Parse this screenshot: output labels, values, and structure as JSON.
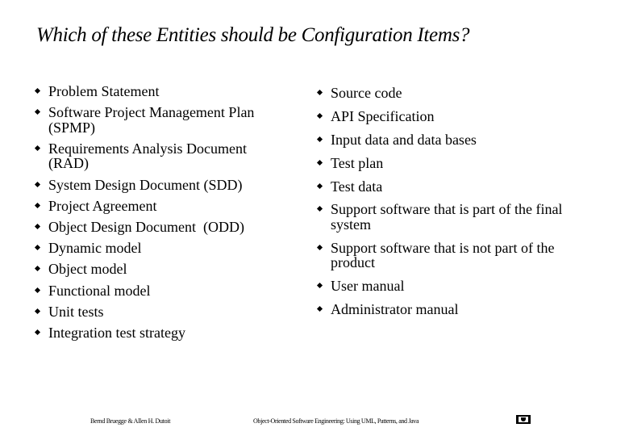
{
  "slide": {
    "title": "Which of these Entities should be Configuration Items?",
    "left_items": [
      "Problem Statement",
      "Software Project Management Plan (SPMP)",
      "Requirements Analysis Document (RAD)",
      "System Design Document (SDD)",
      "Project Agreement",
      "Object Design Document  (ODD)",
      "Dynamic model",
      "Object model",
      "Functional model",
      "Unit tests",
      "Integration test strategy"
    ],
    "right_items": [
      "Source code",
      "API Specification",
      "Input data and data bases",
      "Test plan",
      "Test data",
      "Support software that is part of the final system",
      "Support software that is not part of the product",
      "User manual",
      "Administrator manual"
    ],
    "footer": {
      "authors": "Bernd Bruegge & Allen H. Dutoit",
      "book": "Object-Oriented Software Engineering: Using UML, Patterns, and Java",
      "logo_icon": "university-logo-icon"
    }
  }
}
